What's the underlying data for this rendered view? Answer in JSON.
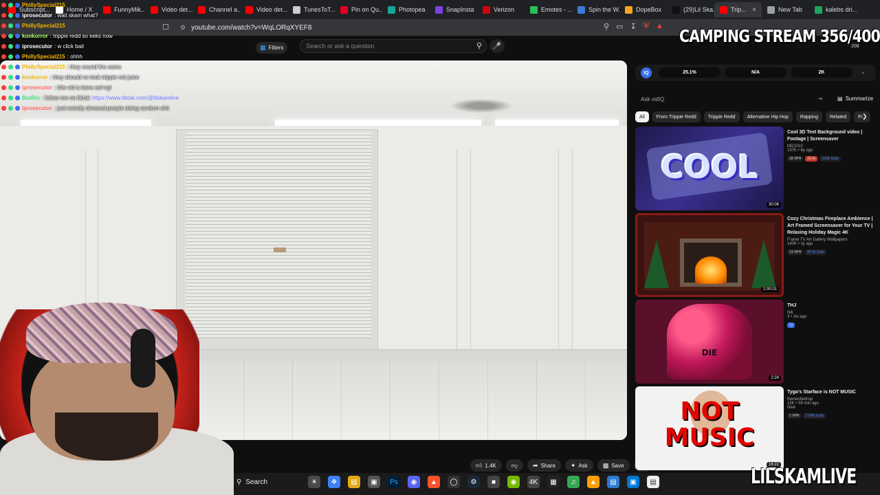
{
  "browser": {
    "tabs": [
      {
        "label": "Subscript...",
        "color": "#ff0000"
      },
      {
        "label": "Home / X",
        "color": "#ffffff"
      },
      {
        "label": "FunnyMik...",
        "color": "#ff0000"
      },
      {
        "label": "Video det...",
        "color": "#ff0000"
      },
      {
        "label": "Channel a...",
        "color": "#ff0000"
      },
      {
        "label": "Video det...",
        "color": "#ff0000"
      },
      {
        "label": "TunesToT...",
        "color": "#cccccc"
      },
      {
        "label": "Pin on Qu...",
        "color": "#e60023"
      },
      {
        "label": "Photopea",
        "color": "#18a497"
      },
      {
        "label": "SnapInsta",
        "color": "#7b3fe4"
      },
      {
        "label": "Verizon",
        "color": "#cd040b"
      },
      {
        "label": "Emotes - ...",
        "color": "#2ebd59"
      },
      {
        "label": "Spin the W...",
        "color": "#3b7bd8"
      },
      {
        "label": "DopeBox",
        "color": "#f5a623"
      },
      {
        "label": "(29)Lil Ska...",
        "color": "#111111"
      },
      {
        "label": "Trip...",
        "color": "#ff0000",
        "active": true
      },
      {
        "label": "New Tab",
        "color": "#9aa0a6"
      },
      {
        "label": "kalebs dri...",
        "color": "#1fa463"
      }
    ],
    "url": "youtube.com/watch?v=WqLORqXYEF8"
  },
  "youtube": {
    "filters_label": "Filters",
    "search_placeholder": "Search or ask a question"
  },
  "chat": [
    {
      "name": "PhillySpecial215",
      "msg": "",
      "color": "#f4b400"
    },
    {
      "name": "iprosecutor",
      "msg": ": wait skam what?",
      "color": "#ffffff"
    },
    {
      "name": "PhillySpecial215",
      "msg": "",
      "color": "#f4b400"
    },
    {
      "name": "konkorror",
      "msg": ": trippie redd so eeks now",
      "color": "#aaff66"
    },
    {
      "name": "iprosecutor",
      "msg": ": w click bait",
      "color": "#ffffff"
    },
    {
      "name": "PhillySpecial215",
      "msg": ": ohhh",
      "color": "#f4b400"
    },
    {
      "name": "PhillySpecial215",
      "msg": ": they sound the same",
      "color": "#f4b400"
    },
    {
      "name": "konkorror",
      "msg": ": they should ve took trippie not juice",
      "color": "#f4b400"
    },
    {
      "name": "iprosecutor",
      "msg": ": this vid is lame asf ngl",
      "color": "#ff6b6b"
    },
    {
      "name": "BotRix",
      "msg": ": follow me on tiktok",
      "color": "#3ddc84",
      "link": "https://www.tiktok.com/@lilskamlive"
    },
    {
      "name": "iprosecutor",
      "msg": ": just weirdly dressed people doing random shit",
      "color": "#ff6b6b"
    }
  ],
  "actions": {
    "likes": "1.4K",
    "share": "Share",
    "ask": "Ask",
    "save": "Save"
  },
  "taskbar": {
    "search_label": "Search"
  },
  "vidiq": {
    "logo": "IQ",
    "stats": [
      "25.1%",
      "N/A",
      "2K"
    ],
    "ask_placeholder": "Ask vidIQ",
    "summarize": "Summarize"
  },
  "chips": [
    "All",
    "From Trippie Redd",
    "Trippie Redd",
    "Alternative Hip Hop",
    "Rapping",
    "Related",
    "Fr..."
  ],
  "recommendations": [
    {
      "title": "Cool 3D Text Background video | Footage | Screensaver",
      "channel": "MD1010",
      "meta": "137K • 6y ago",
      "tags": [
        "18 VPH",
        "25.4x",
        "100K Subs"
      ],
      "duration": "30:06",
      "thumb_text": "COOL"
    },
    {
      "title": "Cozy Christmas Fireplace Ambience | Art Framed Screensaver for Your TV | Relaxing Holiday Magic 4K",
      "channel": "Frame TV Art Gallery Wallpapers",
      "meta": "140K • 1y ago",
      "tags": [
        "13 VPH",
        "85.5k Subs"
      ],
      "duration": "2:00:01",
      "thumb_text": ""
    },
    {
      "title": "THJ",
      "channel": "Nili",
      "meta": "3 • 2w ago",
      "tags": [
        "1x"
      ],
      "duration": "2:24",
      "thumb_text": "DIE"
    },
    {
      "title": "Tyga's Starface is NOT MUSIC",
      "channel": "thenerdledrop",
      "meta": "15K • 59 min ago",
      "tags": [
        "1 VPH",
        "2.09M Subs"
      ],
      "duration": "16:22",
      "thumb_text": "NOT MUSIC",
      "badge": "New"
    }
  ],
  "overlay": {
    "top": "CAMPING STREAM 356/400",
    "bottom": "LILSKAMLIVE",
    "viewers": "208"
  },
  "colors": {
    "youtube_red": "#ff0000",
    "vidiq_blue": "#3a6df0",
    "chip_active": "#f1f1f1"
  }
}
